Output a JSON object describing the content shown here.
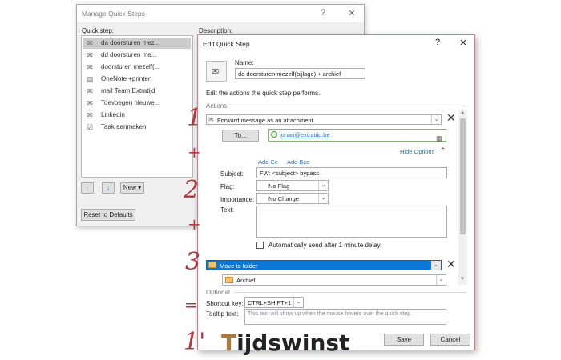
{
  "manage_window": {
    "title": "Manage Quick Steps",
    "help": "?",
    "close": "✕",
    "quick_step_label": "Quick step:",
    "description_label": "Description:",
    "items": [
      {
        "icon": "forward-envelope-icon",
        "label": "da doorsturen mez...",
        "selected": true
      },
      {
        "icon": "forward-envelope-icon",
        "label": "dd doorsturen me...",
        "selected": false
      },
      {
        "icon": "forward-envelope-icon",
        "label": "doorsturen mezelf(...",
        "selected": false
      },
      {
        "icon": "onenote-icon",
        "label": "OneNote +printen",
        "selected": false
      },
      {
        "icon": "mail-icon",
        "label": "mail Team Extratijd",
        "selected": false
      },
      {
        "icon": "forward-envelope-icon",
        "label": "Toevoegen nieuwe...",
        "selected": false
      },
      {
        "icon": "forward-envelope-icon",
        "label": "Linkedin",
        "selected": false
      },
      {
        "icon": "task-icon",
        "label": "Taak aanmaken",
        "selected": false
      }
    ],
    "new_button": "New ▾",
    "reset_button": "Reset to Defaults"
  },
  "edit_window": {
    "title": "Edit Quick Step",
    "help": "?",
    "close": "✕",
    "name_label": "Name:",
    "name_value": "da doorsturen mezelf(bijlage)  + archief",
    "instructions": "Edit the actions the quick step performs.",
    "actions_header": "Actions",
    "action1": "Forward message as an attachment",
    "to_button": "To...",
    "to_value": "johan@extratijd.be",
    "hide_options": "Hide Options",
    "add_cc": "Add Cc",
    "add_bcc": "Add Bcc",
    "subject_label": "Subject:",
    "subject_value": "FW: <subject>  bypass",
    "flag_label": "Flag:",
    "flag_value": "No Flag",
    "importance_label": "Importance:",
    "importance_value": "No Change",
    "text_label": "Text:",
    "auto_send_label": "Automatically send after 1 minute delay.",
    "action2": "Move to folder",
    "folder_value": "Archief",
    "optional_header": "Optional",
    "shortcut_label": "Shortcut key:",
    "shortcut_value": "CTRL+SHIFT+1",
    "tooltip_label": "Tooltip text:",
    "tooltip_placeholder": "This text will show up when the mouse hovers over the quick step.",
    "save_button": "Save",
    "cancel_button": "Cancel"
  },
  "annotations": {
    "n1": "1",
    "plus1": "+",
    "n2": "2",
    "plus2": "+",
    "n3": "3",
    "equals": "=",
    "one_prime": "1'",
    "brand_t": "T",
    "brand_rest": "ijdswinst"
  },
  "colors": {
    "annotation_red": "#b5363f",
    "selection_blue": "#0a78d7",
    "brand_t": "#a87b3c",
    "brand_text": "#222222"
  }
}
